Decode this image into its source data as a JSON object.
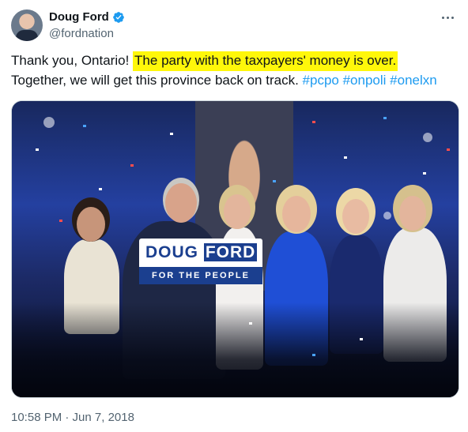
{
  "author": {
    "display_name": "Doug Ford",
    "handle": "@fordnation",
    "verified": true,
    "avatar_icon": "profile-avatar"
  },
  "tweet": {
    "text_before": "Thank you, Ontario!",
    "text_highlighted": "The party with the taxpayers' money is over.",
    "text_line2": "Together, we will get this province back on track.",
    "hashtags": [
      "#pcpo",
      "#onpoli",
      "#onelxn"
    ],
    "timestamp": "10:58 PM · Jun 7, 2018"
  },
  "media": {
    "sign_name_first": "DOUG",
    "sign_name_last": "FORD",
    "sign_slogan": "FOR THE PEOPLE"
  },
  "colors": {
    "highlight": "#fff70a",
    "link": "#1d9bf0",
    "verified": "#1d9bf0",
    "muted": "#536471"
  },
  "icons": {
    "more": "more-options-icon",
    "verified": "verified-badge-icon"
  }
}
